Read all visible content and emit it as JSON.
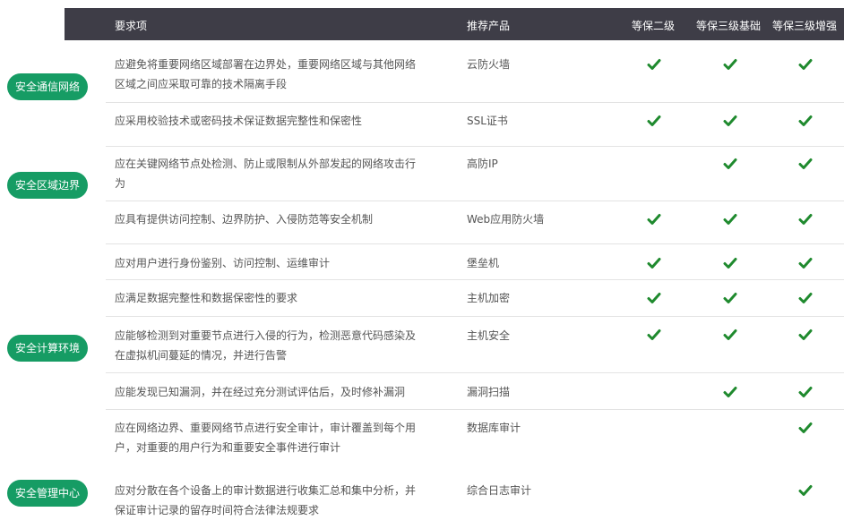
{
  "header": {
    "req": "要求项",
    "product": "推荐产品",
    "level2": "等保二级",
    "level3_basic": "等保三级基础",
    "level3_enhanced": "等保三级增强"
  },
  "categories": [
    "安全通信网络",
    "安全区域边界",
    "安全计算环境",
    "安全管理中心"
  ],
  "rows": [
    {
      "req": "应避免将重要网络区域部署在边界处，重要网络区域与其他网络区域之间应采取可靠的技术隔离手段",
      "product": "云防火墙",
      "l2": true,
      "l3b": true,
      "l3e": true
    },
    {
      "req": "应采用校验技术或密码技术保证数据完整性和保密性",
      "product": "SSL证书",
      "l2": true,
      "l3b": true,
      "l3e": true
    },
    {
      "req": "应在关键网络节点处检测、防止或限制从外部发起的网络攻击行为",
      "product": "高防IP",
      "l2": false,
      "l3b": true,
      "l3e": true
    },
    {
      "req": "应具有提供访问控制、边界防护、入侵防范等安全机制",
      "product": "Web应用防火墙",
      "l2": true,
      "l3b": true,
      "l3e": true
    },
    {
      "req": "应对用户进行身份鉴别、访问控制、运维审计",
      "product": "堡垒机",
      "l2": true,
      "l3b": true,
      "l3e": true
    },
    {
      "req": "应满足数据完整性和数据保密性的要求",
      "product": "主机加密",
      "l2": true,
      "l3b": true,
      "l3e": true
    },
    {
      "req": "应能够检测到对重要节点进行入侵的行为，检测恶意代码感染及在虚拟机间蔓延的情况，并进行告警",
      "product": "主机安全",
      "l2": true,
      "l3b": true,
      "l3e": true
    },
    {
      "req": "应能发现已知漏洞，并在经过充分测试评估后，及时修补漏洞",
      "product": "漏洞扫描",
      "l2": false,
      "l3b": true,
      "l3e": true
    },
    {
      "req": "应在网络边界、重要网络节点进行安全审计，审计覆盖到每个用户，对重要的用户行为和重要安全事件进行审计",
      "product": "数据库审计",
      "l2": false,
      "l3b": false,
      "l3e": true
    },
    {
      "req": "应对分散在各个设备上的审计数据进行收集汇总和集中分析，并保证审计记录的留存时间符合法律法规要求",
      "product": "综合日志审计",
      "l2": false,
      "l3b": false,
      "l3e": true
    }
  ],
  "colors": {
    "header_bg": "#3e3d47",
    "category_bg": "#169c64",
    "check": "#1f8a2e"
  },
  "icons": {
    "check": "check-icon"
  }
}
